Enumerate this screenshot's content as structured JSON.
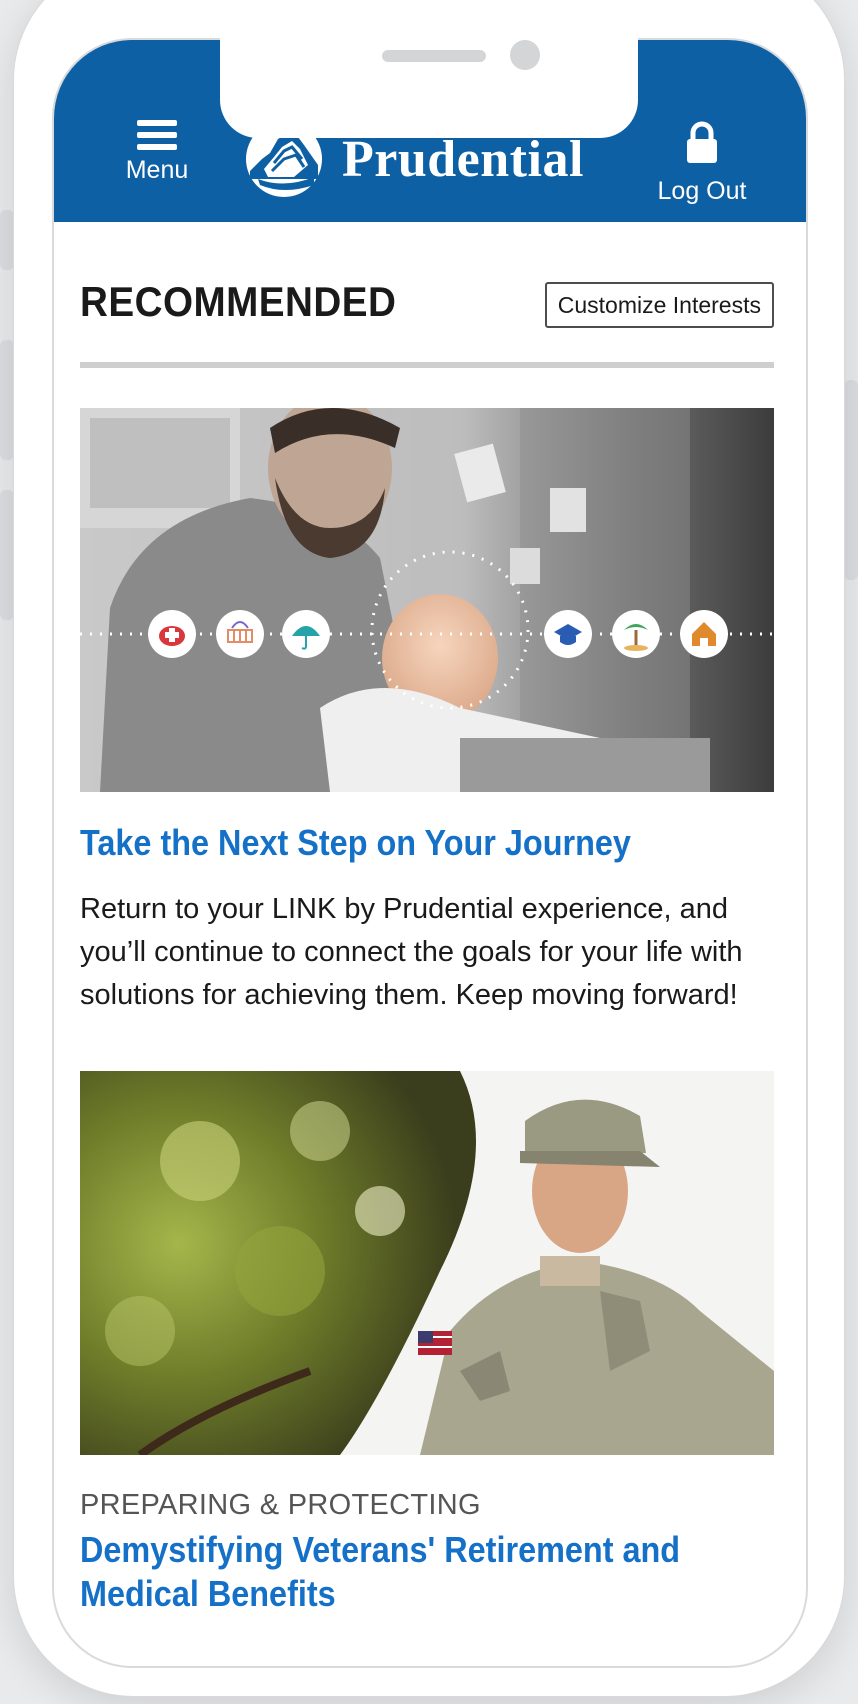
{
  "header": {
    "menu_label": "Menu",
    "brand_name": "Prudential",
    "logout_label": "Log Out",
    "brand_color": "#0e60a5"
  },
  "recommended": {
    "title": "RECOMMENDED",
    "customize_label": "Customize Interests"
  },
  "cards": [
    {
      "title": "Take the Next Step on Your Journey",
      "body": "Return to your LINK by Prudential experience, and you’ll continue to connect the goals for your life with solutions for achieving them. Keep moving forward!",
      "image": "father-with-baby-at-laptop",
      "icons": [
        "piggy-bank-icon",
        "crib-icon",
        "umbrella-icon",
        "graduation-cap-icon",
        "palm-tree-icon",
        "house-icon"
      ]
    },
    {
      "eyebrow": "PREPARING & PROTECTING",
      "title": "Demystifying Veterans' Retirement and Medical Benefits",
      "image": "smiling-soldier-in-uniform"
    }
  ],
  "colors": {
    "link": "#1570c7",
    "text": "#1a1a1a"
  }
}
